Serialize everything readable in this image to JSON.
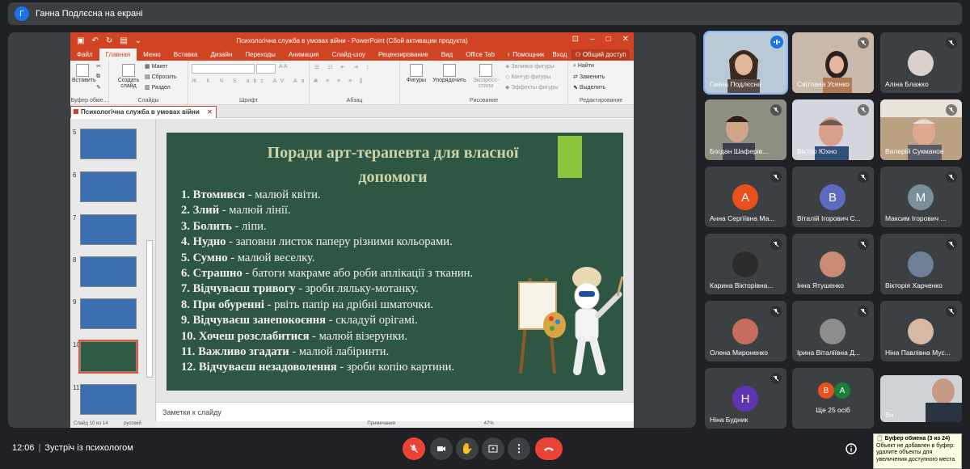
{
  "presenter_bar": {
    "avatar_letter": "Г",
    "text": "Ганна Подлєсна на екрані"
  },
  "ppt": {
    "title": "Психологічна служба в умовах війни - PowerPoint (Сбой активации продукта)",
    "tabs": [
      "Файл",
      "Главная",
      "Меню",
      "Вставка",
      "Дизайн",
      "Переходы",
      "Анимация",
      "Слайд-шоу",
      "Рецензирование",
      "Вид",
      "Office Tab"
    ],
    "help": "Помощник",
    "login": "Вход",
    "share": "Общий доступ",
    "ribbon": {
      "paste": "Вставить",
      "clipboard": "Буфер обме...",
      "new_slide": "Создать слайд",
      "layout": "Макет",
      "reset": "Сбросить",
      "section": "Раздел",
      "slides": "Слайды",
      "font": "Шрифт",
      "paragraph": "Абзац",
      "shapes": "Фигуры",
      "arrange": "Упорядочить",
      "express": "Экспресс-стили",
      "fill": "Заливка фигуры",
      "outline": "Контур фигуры",
      "effects": "Эффекты фигуры",
      "drawing": "Рисование",
      "find": "Найти",
      "replace": "Заменить",
      "select": "Выделить",
      "editing": "Редактирование"
    },
    "doc_tab": "Психологічна служба в умовах війни",
    "thumb_numbers": [
      "5",
      "6",
      "7",
      "8",
      "9",
      "10",
      "11"
    ],
    "slide": {
      "title": "Поради арт-терапевта для власної допомоги",
      "tips": [
        {
          "n": "1.",
          "b": "Втомився",
          "r": " - малюй квіти."
        },
        {
          "n": "2.",
          "b": "Злий",
          "r": " - малюй лінії."
        },
        {
          "n": "3.",
          "b": "Болить",
          "r": " - ліпи."
        },
        {
          "n": "4.",
          "b": "Нудно",
          "r": " - заповни листок паперу різними кольорами."
        },
        {
          "n": "5.",
          "b": "Сумно",
          "r": " - малюй веселку."
        },
        {
          "n": "6.",
          "b": "Страшно",
          "r": " - батоги макраме або роби аплікації з тканин."
        },
        {
          "n": "7.",
          "b": "Відчуваєш тривогу",
          "r": " - зроби ляльку-мотанку."
        },
        {
          "n": "8.",
          "b": "При обуренні",
          "r": " - рвіть папір на дрібні шматочки."
        },
        {
          "n": "9.",
          "b": "Відчуваєш занепокоєння",
          "r": " - складуй орігамі."
        },
        {
          "n": "10.",
          "b": "Хочеш розслабитися",
          "r": " - малюй візерунки."
        },
        {
          "n": "11.",
          "b": "Важливо згадати",
          "r": " - малюй лабіринти."
        },
        {
          "n": "12.",
          "b": "Відчуваєш незадоволення",
          "r": " - зроби копію картини."
        }
      ]
    },
    "notes": "Заметки к слайду",
    "status": {
      "slide": "Слайд 10 из 14",
      "lang": "русский",
      "notes": "Примечания",
      "zoom": "47%"
    }
  },
  "participants": [
    {
      "name": "Ганна Подлєсна",
      "type": "video",
      "speaking": true
    },
    {
      "name": "Світлана Усенко",
      "type": "video"
    },
    {
      "name": "Аліна Блажко",
      "type": "photo"
    },
    {
      "name": "Богдан Шаферів...",
      "type": "video"
    },
    {
      "name": "Віктор Юхно",
      "type": "video"
    },
    {
      "name": "Валерій Сукманов",
      "type": "video"
    },
    {
      "name": "Анна Сергіївна Ма...",
      "type": "avatar",
      "letter": "А",
      "color": "#e8501c"
    },
    {
      "name": "Віталій Ігорович С...",
      "type": "avatar",
      "letter": "В",
      "color": "#5c6bc0"
    },
    {
      "name": "Максим Ігорович ...",
      "type": "avatar",
      "letter": "М",
      "color": "#78909c"
    },
    {
      "name": "Карина Вікторівна...",
      "type": "photo"
    },
    {
      "name": "Інна Ятушенко",
      "type": "photo"
    },
    {
      "name": "Вікторія Харченко",
      "type": "photo"
    },
    {
      "name": "Олена Мироненко",
      "type": "photo"
    },
    {
      "name": "Ірина Віталіївна Д...",
      "type": "photo"
    },
    {
      "name": "Ніна Павлівна Мус...",
      "type": "photo"
    },
    {
      "name": "Ніна Будник",
      "type": "avatar",
      "letter": "Н",
      "color": "#5e35b1"
    },
    {
      "name": "Ще 25 осіб",
      "type": "more",
      "letters": [
        "В",
        "А"
      ]
    },
    {
      "name": "Ви",
      "type": "video"
    }
  ],
  "bottom": {
    "time": "12:06",
    "meeting": "Зустріч із психологом"
  },
  "clipboard_tip": {
    "title": "Буфер обмена (3 из 24)",
    "text": "Объект не добавлен в буфер: удалите объекты для увеличения доступного места"
  }
}
